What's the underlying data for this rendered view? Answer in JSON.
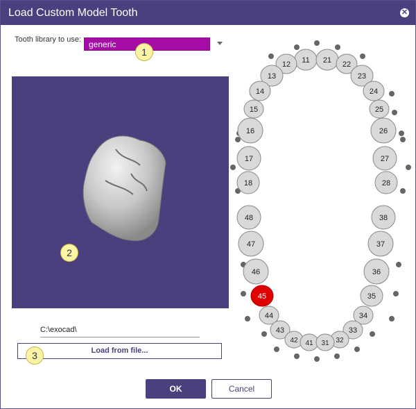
{
  "window": {
    "title": "Load Custom Model Tooth",
    "close_icon": "close-icon"
  },
  "library": {
    "label": "Tooth library to use:",
    "selected": "generic"
  },
  "badges": {
    "b1": "1",
    "b2": "2",
    "b3": "3"
  },
  "path": {
    "value": "C:\\exocad\\"
  },
  "buttons": {
    "load": "Load from file...",
    "ok": "OK",
    "cancel": "Cancel"
  },
  "teeth": {
    "upper": [
      "11",
      "21",
      "12",
      "22",
      "13",
      "23",
      "14",
      "24",
      "15",
      "25",
      "16",
      "26",
      "17",
      "27",
      "18",
      "28"
    ],
    "lower": [
      "48",
      "38",
      "47",
      "37",
      "46",
      "36",
      "45",
      "35",
      "44",
      "34",
      "43",
      "33",
      "42",
      "32",
      "41",
      "31"
    ],
    "selected": "45"
  },
  "colors": {
    "accent": "#4b3f7d",
    "select_bg": "#a60da6",
    "selected_tooth": "#e00000"
  }
}
